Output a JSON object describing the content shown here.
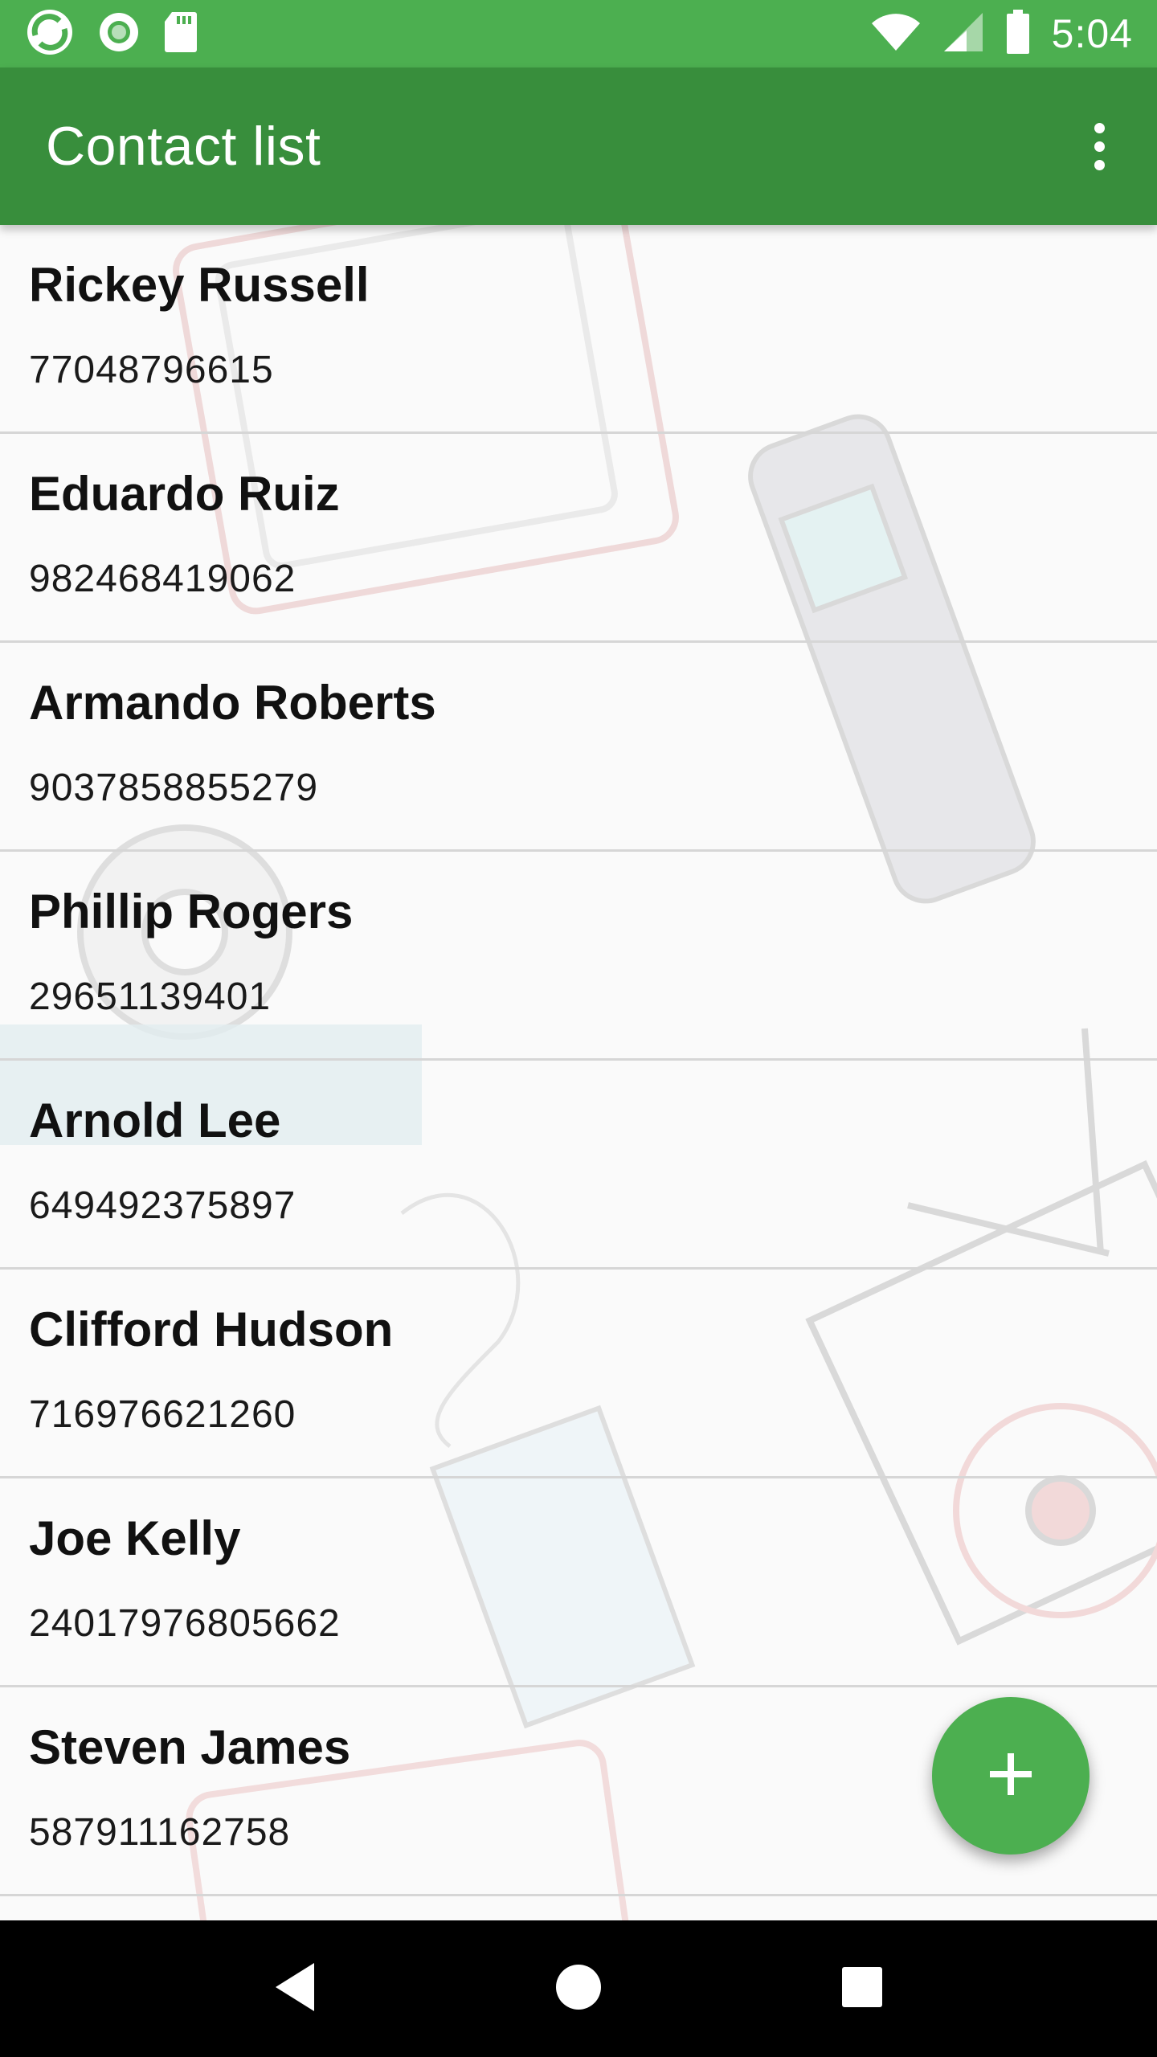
{
  "status_bar": {
    "time": "5:04",
    "icons_left": [
      "sync-icon",
      "record-icon",
      "sd-card-icon"
    ],
    "icons_right": [
      "wifi-icon",
      "cell-signal-icon",
      "battery-icon"
    ]
  },
  "app_bar": {
    "title": "Contact list",
    "menu_icon": "more-vert-icon"
  },
  "contacts": [
    {
      "name": "Rickey Russell",
      "phone": "77048796615"
    },
    {
      "name": "Eduardo Ruiz",
      "phone": "982468419062"
    },
    {
      "name": "Armando Roberts",
      "phone": "9037858855279"
    },
    {
      "name": "Phillip Rogers",
      "phone": "29651139401"
    },
    {
      "name": "Arnold Lee",
      "phone": "649492375897"
    },
    {
      "name": "Clifford Hudson",
      "phone": "716976621260"
    },
    {
      "name": "Joe Kelly",
      "phone": "24017976805662"
    },
    {
      "name": "Steven James",
      "phone": "587911162758"
    }
  ],
  "fab": {
    "icon": "add-icon"
  },
  "nav_bar": {
    "icons": [
      "back-icon",
      "home-icon",
      "recents-icon"
    ]
  },
  "colors": {
    "status_bar": "#4caf50",
    "app_bar": "#388e3c",
    "fab": "#4caf50",
    "nav_bar": "#000000"
  }
}
